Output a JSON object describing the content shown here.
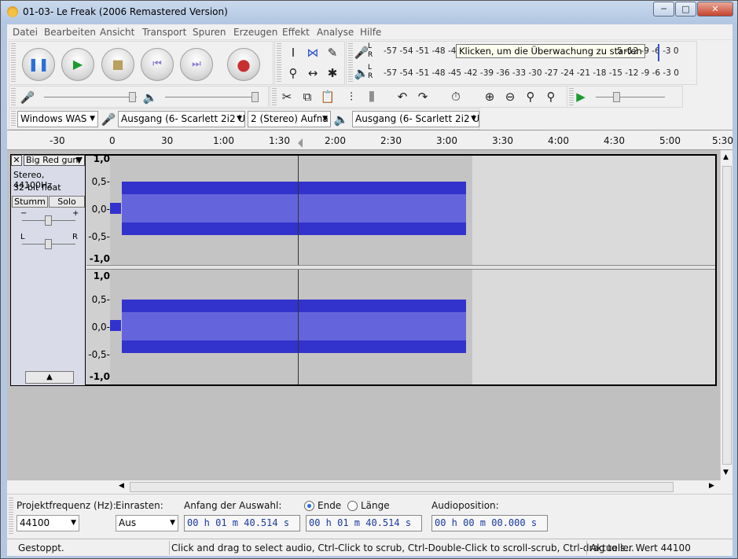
{
  "window": {
    "title": "01-03- Le Freak (2006 Remastered Version)",
    "minimize": "─",
    "maximize": "□",
    "close": "✕"
  },
  "menu": [
    "Datei",
    "Bearbeiten",
    "Ansicht",
    "Transport",
    "Spuren",
    "Erzeugen",
    "Effekt",
    "Analyse",
    "Hilfe"
  ],
  "meters": {
    "record_scale": "-57 -54 -51 -48 -4",
    "record_scale_right": "5 -12 -9  -6  -3  0",
    "tooltip": "Klicken, um die Überwachung zu starten",
    "play_scale": "-57 -54 -51 -48 -45 -42 -39 -36 -33 -30 -27 -24 -21 -18 -15 -12  -9  -6  -3  0",
    "lr": "L R"
  },
  "devices": {
    "host": "Windows WAS",
    "input": "Ausgang (6- Scarlett 2i2 US",
    "channels": "2 (Stereo) Aufna",
    "output": "Ausgang (6- Scarlett 2i2 US"
  },
  "ruler": [
    "-30",
    "0",
    "30",
    "1:00",
    "1:30",
    "2:00",
    "2:30",
    "3:00",
    "3:30",
    "4:00",
    "4:30",
    "5:00",
    "5:30"
  ],
  "track": {
    "name": "Big Red gun",
    "info1": "Stereo, 44100Hz",
    "info2": "32-bit float",
    "mute": "Stumm",
    "solo": "Solo",
    "gain_minus": "−",
    "gain_plus": "+",
    "pan_l": "L",
    "pan_r": "R",
    "scale": [
      "1,0",
      "0,5-",
      "0,0-",
      "-0,5-",
      "-1,0"
    ]
  },
  "selection": {
    "rate_label": "Projektfrequenz (Hz):",
    "rate_value": "44100",
    "snap_label": "Einrasten:",
    "snap_value": "Aus",
    "start_label": "Anfang der Auswahl:",
    "end_label": "Ende",
    "length_label": "Länge",
    "start_value": "00 h 01 m 40.514 s",
    "end_value": "00 h 01 m 40.514 s",
    "audiopos_label": "Audioposition:",
    "audiopos_value": "00 h 00 m 00.000 s"
  },
  "status": {
    "state": "Gestoppt.",
    "hint": "Click and drag to select audio, Ctrl-Click to scrub, Ctrl-Double-Click to scroll-scrub, Ctrl-drag to s...",
    "value": "Aktueller Wert 44100"
  }
}
